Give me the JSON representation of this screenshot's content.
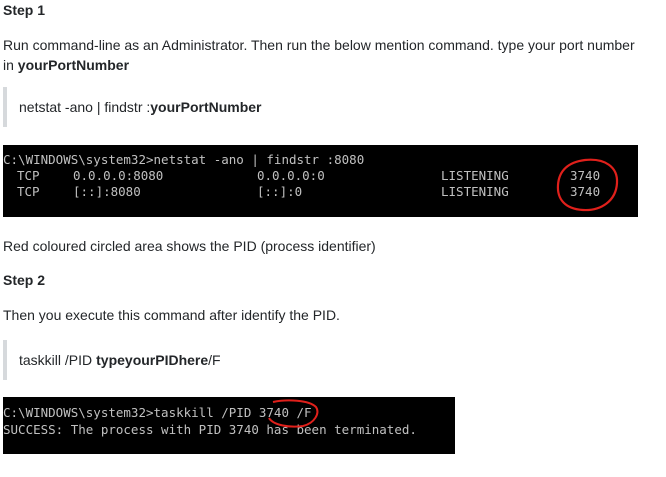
{
  "step1": {
    "heading": "Step 1",
    "instruction_plain": "Run command-line as an Administrator. Then run the below mention command. type your port number in ",
    "instruction_bold": "yourPortNumber",
    "command_plain": "netstat -ano | findstr :",
    "command_bold": "yourPortNumber"
  },
  "terminal1": {
    "prompt_line": "C:\\WINDOWS\\system32>netstat -ano | findstr :8080",
    "rows": [
      {
        "proto": "TCP",
        "local": "0.0.0.0:8080",
        "foreign": "0.0.0.0:0",
        "state": "LISTENING",
        "pid": "3740"
      },
      {
        "proto": "TCP",
        "local": "[::]:8080",
        "foreign": "[::]:0",
        "state": "LISTENING",
        "pid": "3740"
      }
    ]
  },
  "note": "Red coloured circled area shows the PID (process identifier)",
  "step2": {
    "heading": "Step 2",
    "instruction": "Then you execute this command after identify the PID.",
    "command_plain_1": "taskkill /PID ",
    "command_bold": "typeyourPIDhere",
    "command_plain_2": " /F"
  },
  "terminal2": {
    "prompt": "C:\\WINDOWS\\system32>taskkill /PID ",
    "pid": "3740",
    "suffix": " /F",
    "success": "SUCCESS: The process with PID 3740 has been terminated."
  },
  "colors": {
    "annotation_red": "#e0201b",
    "terminal_bg": "#000000",
    "terminal_text": "#c0c0c0",
    "quote_bar": "#d6d9dc"
  }
}
